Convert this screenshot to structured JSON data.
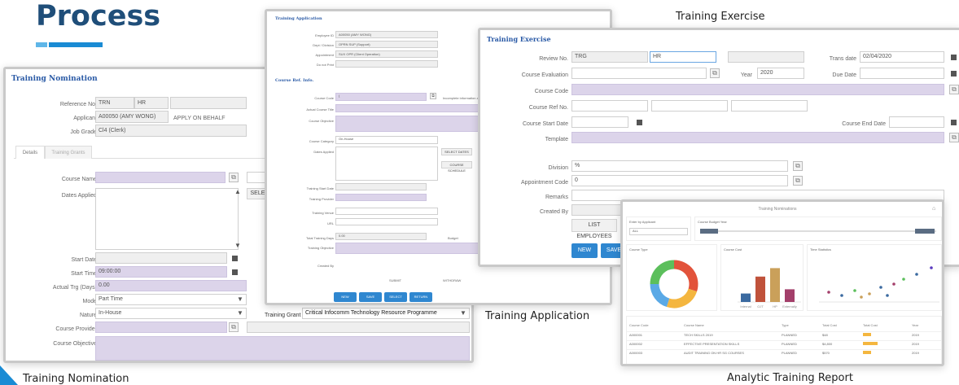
{
  "title": "Process",
  "captions": {
    "nomination": "Training Nomination",
    "application": "Training Application",
    "exercise": "Training Exercise",
    "analytic": "Analytic Training Report"
  },
  "nomination": {
    "title": "Training Nomination",
    "reference_label": "Reference No.",
    "reference_1": "TRN",
    "reference_2": "HR",
    "applicant_label": "Applicant",
    "applicant_value": "A00050 (AMY WONG)",
    "apply_behalf": "APPLY ON BEHALF",
    "job_grade_label": "Job Grade",
    "job_grade_value": "Cl4 (Clerk)",
    "tabs": [
      "Details",
      "Training Grants"
    ],
    "course_name_label": "Course Name",
    "dates_applied_label": "Dates Applied",
    "select_label": "SELECT I",
    "start_date_label": "Start Date",
    "start_time_label": "Start Time",
    "start_time_value": "09:00:00",
    "actual_trg_label": "Actual Trg (Days)",
    "actual_trg_value": "0.00",
    "mode_label": "Mode",
    "mode_value": "Part Time",
    "nature_label": "Nature",
    "nature_value": "In-House",
    "course_provider_label": "Course Provider",
    "course_objective_label": "Course Objective",
    "training_grant_label": "Training Grant",
    "training_grant_value": "Critical Infocomm Technology Resource Programme"
  },
  "application": {
    "title": "Training Application",
    "section_title": "Course Ref. Info.",
    "rows_top": [
      {
        "label": "Employee ID",
        "value": "A00050 (AMY WONG)"
      },
      {
        "label": "Dept / Division",
        "value": "OPRN SUP (Support)"
      },
      {
        "label": "Appointment",
        "value": "SUX OPR (Client Operation)"
      },
      {
        "label": "Do not Print",
        "value": ""
      }
    ],
    "course_code_label": "Course Code",
    "course_code_value": "(",
    "course_code_extra": "Incomplete information ad",
    "actual_title_label": "Actual Course Title",
    "course_objective_label": "Course Objective",
    "course_category_label": "Course Category",
    "course_category_value": "On-House",
    "dates_applied_label": "Dates Applied",
    "select_dates": "SELECT DATES",
    "course_schedule": "COURSE SCHEDULE",
    "training_start_label": "Training Start Date",
    "training_provider_label": "Training Provider",
    "training_venue_label": "Training Venue",
    "url_label": "URL",
    "total_days_label": "Total Training Days",
    "total_days_value": "0.00",
    "budget_label": "Budget",
    "training_objective_label": "Training Objective",
    "created_by_label": "Created By",
    "submit_label": "SUBMIT",
    "withdraw_label": "WITHDRAW",
    "actions": [
      "NEW",
      "SAVE",
      "SELECT",
      "RETURN"
    ]
  },
  "exercise": {
    "title": "Training Exercise",
    "review_label": "Review No.",
    "review_1": "TRG",
    "review_2": "HR",
    "trans_date_label": "Trans date",
    "trans_date_value": "02/04/2020",
    "course_evaluation_label": "Course Evaluation",
    "year_label": "Year",
    "year_value": "2020",
    "due_date_label": "Due Date",
    "course_code_label": "Course Code",
    "course_ref_label": "Course Ref No.",
    "course_start_label": "Course Start Date",
    "course_end_label": "Course End Date",
    "template_label": "Template",
    "division_label": "Division",
    "division_value": "%",
    "appointment_label": "Appointment Code",
    "appointment_value": "0",
    "remarks_label": "Remarks",
    "created_by_label": "Created By",
    "list_employees": "LIST EMPLOYEES",
    "new_label": "NEW",
    "save_label": "SAVE"
  },
  "analytic": {
    "title": "Training Nominations",
    "filter_1_label": "Enter by Applicant",
    "filter_1_value": "ALL",
    "filter_2_label": "Course Budget Year",
    "table_headers": [
      "Course Code",
      "Course Name",
      "Type",
      "Total Cost",
      "Total Cost",
      "Year"
    ],
    "table_rows": [
      [
        "A000001",
        "TECH SKILLS 2019",
        "PLANNED",
        "$48",
        "2019"
      ],
      [
        "A000002",
        "EFFECTIVE PRESENTATION SKILLS",
        "PLANNED",
        "$4,800",
        "2019"
      ],
      [
        "A000003",
        "AUDIT TRAINING ON HR SG COURSES",
        "PLANNED",
        "$570",
        "2019"
      ]
    ],
    "panels": [
      "Course Type",
      "Course Cost",
      "Time Statistics"
    ],
    "bar_labels": [
      "Internal",
      "OJT",
      "HP",
      "Externally"
    ],
    "bar_values": [
      0.2,
      0.6,
      0.8,
      0.3
    ],
    "pie_colors": [
      "#e2533b",
      "#f4b63f",
      "#5aa9e6",
      "#5cbf5c"
    ],
    "bar_colors": [
      "#3b6aa0",
      "#c0523b",
      "#caa05a",
      "#a33f6a"
    ]
  }
}
